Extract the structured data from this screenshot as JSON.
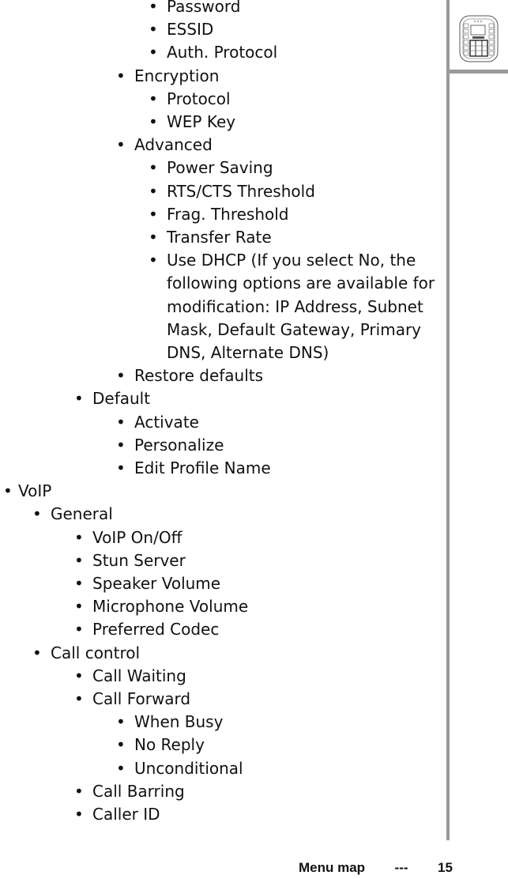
{
  "menu_items": [
    {
      "label": "Password",
      "level": "A"
    },
    {
      "label": "ESSID",
      "level": "A"
    },
    {
      "label": "Auth. Protocol",
      "level": "A"
    },
    {
      "label": "Encryption",
      "level": "B"
    },
    {
      "label": "Protocol",
      "level": "A"
    },
    {
      "label": "WEP Key",
      "level": "A"
    },
    {
      "label": "Advanced",
      "level": "B"
    },
    {
      "label": "Power Saving",
      "level": "A"
    },
    {
      "label": "RTS/CTS Threshold",
      "level": "A"
    },
    {
      "label": "Frag. Threshold",
      "level": "A"
    },
    {
      "label": "Transfer Rate",
      "level": "A"
    },
    {
      "label": "Use DHCP (If you select No, the following options are available for modification: IP Address, Subnet Mask, Default Gateway, Primary DNS, Alternate DNS)",
      "level": "A"
    },
    {
      "label": "Restore defaults",
      "level": "B"
    },
    {
      "label": "Default",
      "level": "C"
    },
    {
      "label": "Activate",
      "level": "B"
    },
    {
      "label": "Personalize",
      "level": "B"
    },
    {
      "label": "Edit Profile Name",
      "level": "B"
    },
    {
      "label": "VoIP",
      "level": "E"
    },
    {
      "label": "General",
      "level": "D"
    },
    {
      "label": "VoIP On/Off",
      "level": "C"
    },
    {
      "label": "Stun Server",
      "level": "C"
    },
    {
      "label": "Speaker Volume",
      "level": "C"
    },
    {
      "label": "Microphone Volume",
      "level": "C"
    },
    {
      "label": "Preferred Codec",
      "level": "C"
    },
    {
      "label": "Call control",
      "level": "D"
    },
    {
      "label": "Call Waiting",
      "level": "C"
    },
    {
      "label": "Call Forward",
      "level": "C"
    },
    {
      "label": "When Busy",
      "level": "B"
    },
    {
      "label": "No Reply",
      "level": "B"
    },
    {
      "label": "Unconditional",
      "level": "B"
    },
    {
      "label": "Call Barring",
      "level": "C"
    },
    {
      "label": "Caller ID",
      "level": "C"
    }
  ],
  "bullet_glyph": "•",
  "sidebar": {
    "icon": "phone-icon",
    "bar_color": "#9a9a9a"
  },
  "footer": {
    "section": "Menu map",
    "separator": "---",
    "page_number": "15"
  }
}
